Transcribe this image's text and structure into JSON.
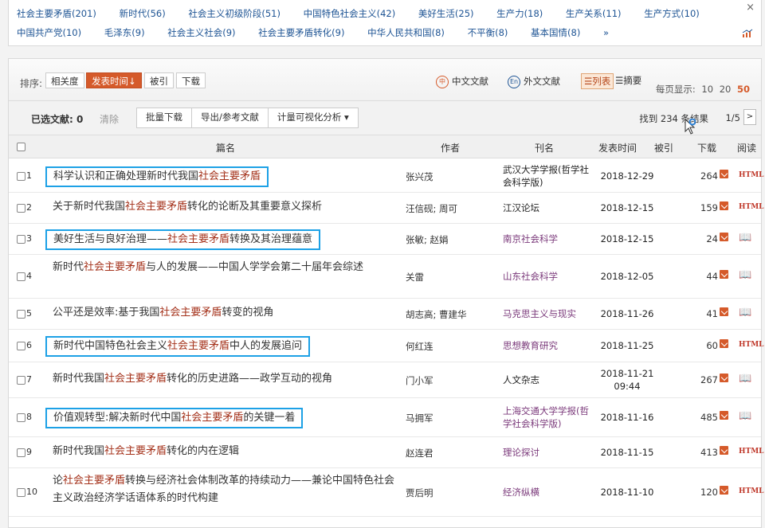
{
  "tags": {
    "row1": [
      {
        "label": "社会主要矛盾",
        "count": "(201)"
      },
      {
        "label": "新时代",
        "count": "(56)"
      },
      {
        "label": "社会主义初级阶段",
        "count": "(51)"
      },
      {
        "label": "中国特色社会主义",
        "count": "(42)"
      },
      {
        "label": "美好生活",
        "count": "(25)"
      },
      {
        "label": "生产力",
        "count": "(18)"
      },
      {
        "label": "生产关系",
        "count": "(11)"
      },
      {
        "label": "生产方式",
        "count": "(10)"
      }
    ],
    "row2": [
      {
        "label": "中国共产党",
        "count": "(10)"
      },
      {
        "label": "毛泽东",
        "count": "(9)"
      },
      {
        "label": "社会主义社会",
        "count": "(9)"
      },
      {
        "label": "社会主要矛盾转化",
        "count": "(9)"
      },
      {
        "label": "中华人民共和国",
        "count": "(8)"
      },
      {
        "label": "不平衡",
        "count": "(8)"
      },
      {
        "label": "基本国情",
        "count": "(8)"
      }
    ],
    "more": "»",
    "close": "×"
  },
  "sortbar": {
    "label": "排序:",
    "buttons": [
      "相关度",
      "发表时间↓",
      "被引",
      "下载"
    ],
    "chinese_lit": "中文文献",
    "foreign_lit": "外文文献",
    "view_list": "☰列表",
    "view_abstract": "☰摘要",
    "perpage_label": "每页显示:",
    "perpage_options": [
      "10",
      "20",
      "50"
    ]
  },
  "selbar": {
    "selected_label": "已选文献:",
    "selected_count": "0",
    "clear": "清除",
    "tools": [
      "批量下载",
      "导出/参考文献",
      "计量可视化分析 ▾"
    ],
    "found": "找到 234 条结果",
    "page": "1/5",
    "next": ">"
  },
  "headers": {
    "title": "篇名",
    "author": "作者",
    "journal": "刊名",
    "date": "发表时间",
    "cited": "被引",
    "download": "下载",
    "read": "阅读"
  },
  "rows": [
    {
      "num": "1",
      "t1": "科学认识和正确处理新时代我国",
      "hl": "社会主要矛盾",
      "t2": "",
      "author": "张兴茂",
      "journal": "武汉大学学报(哲学社会科学版)",
      "date": "2018-12-29",
      "dl": "264",
      "read": "HTML"
    },
    {
      "num": "2",
      "t1": "关于新时代我国",
      "hl": "社会主要矛盾",
      "t2": "转化的论断及其重要意义探析",
      "author": "汪信砚; 周可",
      "journal": "江汉论坛",
      "date": "2018-12-15",
      "dl": "159",
      "read": "HTML"
    },
    {
      "num": "3",
      "t1": "美好生活与良好治理——",
      "hl": "社会主要矛盾",
      "t2": "转换及其治理蕴意",
      "author": "张敏; 赵娟",
      "journal": "南京社会科学",
      "date": "2018-12-15",
      "dl": "24",
      "read": "📖"
    },
    {
      "num": "4",
      "t1": "新时代",
      "hl": "社会主要矛盾",
      "t2": "与人的发展——中国人学学会第二十届年会综述",
      "author": "关雷",
      "journal": "山东社会科学",
      "date": "2018-12-05",
      "dl": "44",
      "read": "📖"
    },
    {
      "num": "5",
      "t1": "公平还是效率:基于我国",
      "hl": "社会主要矛盾",
      "t2": "转变的视角",
      "author": "胡志高; 曹建华",
      "journal": "马克思主义与现实",
      "date": "2018-11-26",
      "dl": "41",
      "read": "📖"
    },
    {
      "num": "6",
      "t1": "新时代中国特色社会主义",
      "hl": "社会主要矛盾",
      "t2": "中人的发展追问",
      "author": "何红连",
      "journal": "思想教育研究",
      "date": "2018-11-25",
      "dl": "60",
      "read": "HTML"
    },
    {
      "num": "7",
      "t1": "新时代我国",
      "hl": "社会主要矛盾",
      "t2": "转化的历史进路——政学互动的视角",
      "author": "门小军",
      "journal": "人文杂志",
      "date": "2018-11-21",
      "date2": "09:44",
      "dl": "267",
      "read": "📖"
    },
    {
      "num": "8",
      "t1": "价值观转型:解决新时代中国",
      "hl": "社会主要矛盾",
      "t2": "的关键一着",
      "author": "马拥军",
      "journal": "上海交通大学学报(哲学社会科学版)",
      "date": "2018-11-16",
      "dl": "485",
      "read": "📖"
    },
    {
      "num": "9",
      "t1": "新时代我国",
      "hl": "社会主要矛盾",
      "t2": "转化的内在逻辑",
      "author": "赵连君",
      "journal": "理论探讨",
      "date": "2018-11-15",
      "dl": "413",
      "read": "HTML"
    },
    {
      "num": "10",
      "t1": "论",
      "hl": "社会主要矛盾",
      "t2": "转换与经济社会体制改革的持续动力——兼论中国特色社会主义政治经济学话语体系的时代构建",
      "author": "贾后明",
      "journal": "经济纵横",
      "date": "2018-11-10",
      "dl": "120",
      "read": "HTML"
    }
  ]
}
